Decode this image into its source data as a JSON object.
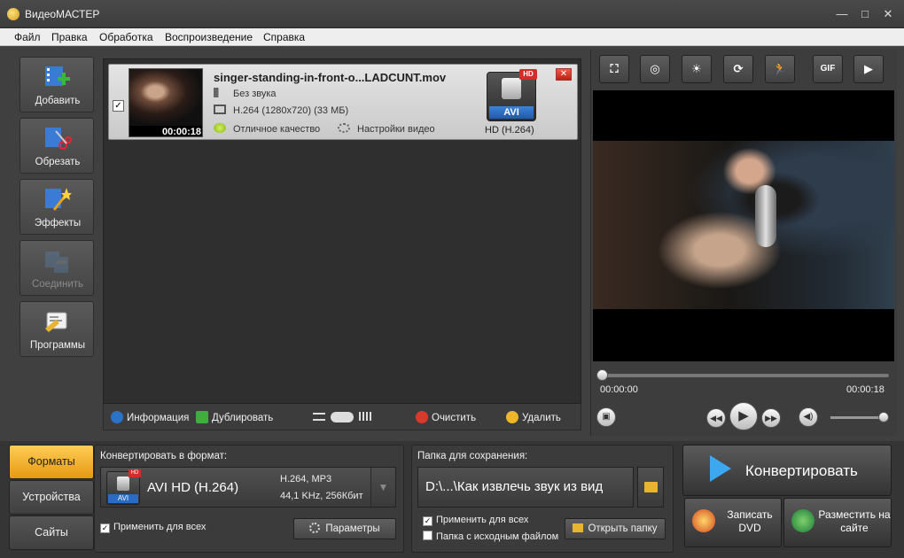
{
  "window": {
    "title": "ВидеоМАСТЕР",
    "controls": {
      "minimize": "—",
      "maximize": "□",
      "close": "✕"
    }
  },
  "menu": [
    "Файл",
    "Правка",
    "Обработка",
    "Воспроизведение",
    "Справка"
  ],
  "tools": [
    {
      "label": "Добавить",
      "icon": "add-video-icon",
      "enabled": true
    },
    {
      "label": "Обрезать",
      "icon": "cut-icon",
      "enabled": true
    },
    {
      "label": "Эффекты",
      "icon": "effects-icon",
      "enabled": true
    },
    {
      "label": "Соединить",
      "icon": "join-icon",
      "enabled": false
    },
    {
      "label": "Программы",
      "icon": "programs-icon",
      "enabled": true
    }
  ],
  "file": {
    "name": "singer-standing-in-front-o...LADCUNT.mov",
    "duration": "00:00:18",
    "audio": "Без звука",
    "video": "H.264 (1280x720) (33 МБ)",
    "quality": "Отличное качество",
    "settings": "Настройки видео",
    "format_badge": "AVI",
    "format_hd": "HD",
    "format_label": "HD (H.264)",
    "checked": "✓",
    "remove": "✕"
  },
  "file_toolbar": {
    "info": "Информация",
    "duplicate": "Дублировать",
    "clear": "Очистить",
    "delete": "Удалить"
  },
  "preview": {
    "tools": [
      {
        "icon": "crop-icon",
        "glyph": "⛶"
      },
      {
        "icon": "watermark-icon",
        "glyph": "◎"
      },
      {
        "icon": "brightness-icon",
        "glyph": "☀"
      },
      {
        "icon": "rotate-icon",
        "glyph": "⟳"
      },
      {
        "icon": "speed-icon",
        "glyph": "🏃"
      },
      {
        "icon": "gif-icon",
        "glyph": "GIF"
      },
      {
        "icon": "play-frame-icon",
        "glyph": "▶"
      }
    ],
    "time_current": "00:00:00",
    "time_total": "00:00:18",
    "progress": 0,
    "volume": 1.0
  },
  "bottom": {
    "tabs": [
      "Форматы",
      "Устройства",
      "Сайты"
    ],
    "active_tab": 0,
    "format_title": "Конвертировать в формат:",
    "format_name": "AVI HD (H.264)",
    "format_icon_text": "AVI",
    "format_icon_hd": "HD",
    "format_codecs": "H.264, MP3",
    "format_audio": "44,1 KHz, 256Кбит",
    "apply_all": "Применить для всех",
    "params": "Параметры",
    "save_title": "Папка для сохранения:",
    "save_path": "D:\\...\\Как извлечь звук из вид",
    "apply_all_2": "Применить для всех",
    "source_folder": "Папка с исходным файлом",
    "open_folder": "Открыть папку",
    "convert": "Конвертировать",
    "burn_dvd": "Записать DVD",
    "publish": "Разместить на сайте",
    "check": "✓",
    "dropdown": "▼"
  },
  "colors": {
    "accent": "#f0a824",
    "convert_arrow": "#3da7f0",
    "hd_red": "#d62b2b",
    "avi_blue": "#1f5aa8"
  }
}
